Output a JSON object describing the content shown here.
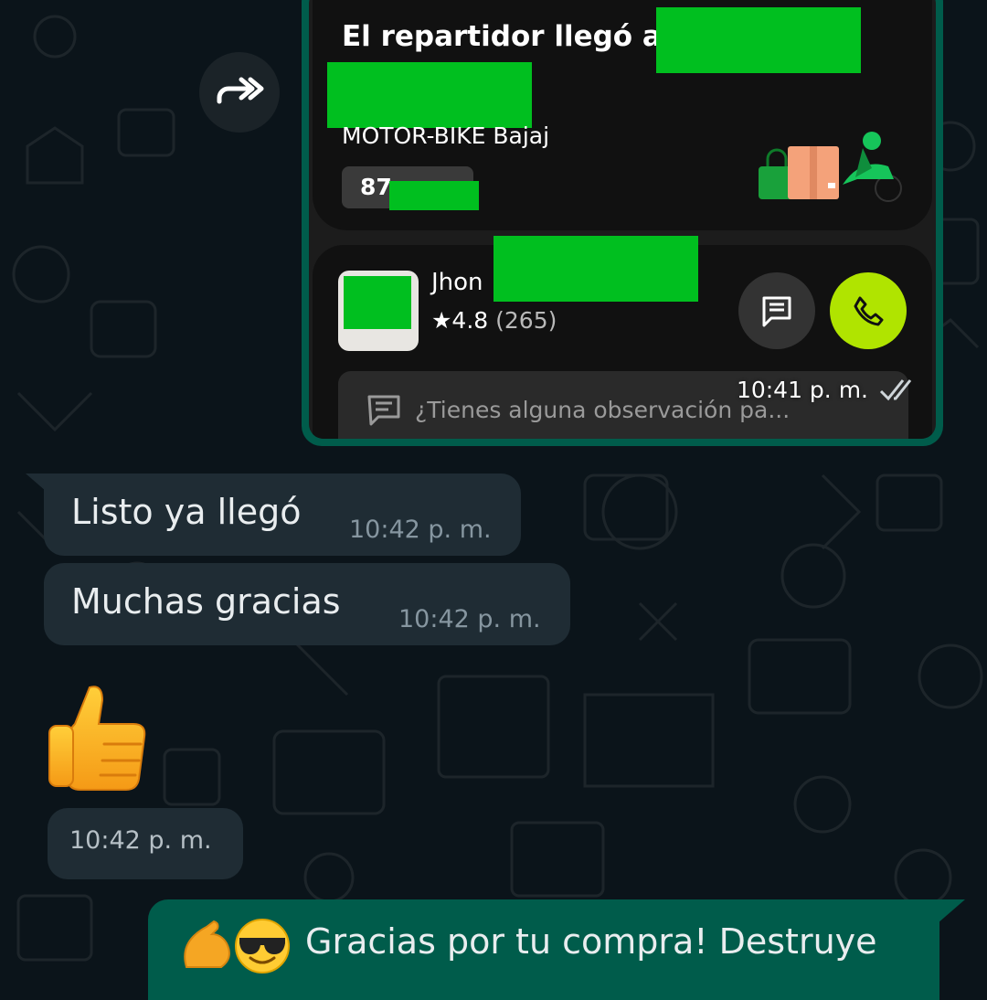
{
  "forward_button": {
    "icon": "forward-icon"
  },
  "shared_screenshot": {
    "title": "El repartidor llegó a",
    "vehicle": "MOTOR-BIKE Bajaj",
    "plate": "87",
    "driver_name": "Jhon",
    "rating_value": "★4.8",
    "rating_count": "(265)",
    "observation_placeholder": "¿Tienes alguna observación pa...",
    "time": "10:41 p. m.",
    "status_icon": "double-check-icon",
    "redaction_color": "#00bf1f",
    "call_button_color": "#b0e400"
  },
  "messages": [
    {
      "text": "Listo ya llegó",
      "time": "10:42 p. m."
    },
    {
      "text": "Muchas gracias",
      "time": "10:42 p. m."
    },
    {
      "emoji": "👍",
      "time": "10:42 p. m."
    }
  ],
  "outgoing_message": {
    "emojis": [
      "💪",
      "😎"
    ],
    "text": "Gracias por tu compra! Destruye"
  },
  "colors": {
    "chat_background": "#0b141a",
    "incoming_bubble": "#1f2c34",
    "outgoing_bubble": "#005c4b",
    "timestamp": "#8696a0"
  }
}
